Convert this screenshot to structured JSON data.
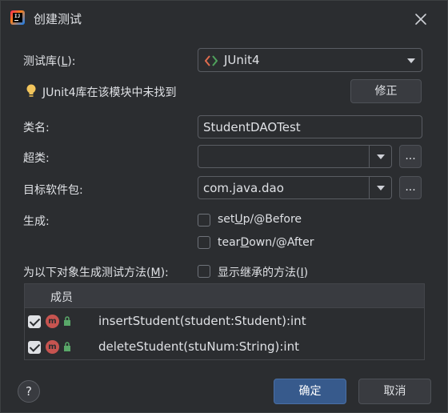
{
  "window": {
    "title": "创建测试"
  },
  "form": {
    "test_library": {
      "label": "测试库(",
      "mnemonic": "L",
      "label_end": "):",
      "value": "JUnit4"
    },
    "warning": {
      "text": "JUnit4库在该模块中未找到",
      "fix_label": "修正"
    },
    "class_name": {
      "label": "类名:",
      "value": "StudentDAOTest"
    },
    "superclass": {
      "label": "超类:",
      "value": ""
    },
    "target_package": {
      "label": "目标软件包:",
      "value": "com.java.dao"
    },
    "ellipsis_label": "...",
    "generate": {
      "label": "生成:",
      "setup": {
        "prefix": "set",
        "mnemonic": "U",
        "suffix": "p/@Before",
        "checked": false
      },
      "teardown": {
        "prefix": "tear",
        "mnemonic": "D",
        "suffix": "own/@After",
        "checked": false
      }
    },
    "methods_for": {
      "label": "为以下对象生成测试方法(",
      "mnemonic": "M",
      "label_end": "):"
    },
    "show_inherited": {
      "label": "显示继承的方法(",
      "mnemonic": "I",
      "label_end": ")",
      "checked": false
    }
  },
  "members": {
    "header": "成员",
    "rows": [
      {
        "signature": "insertStudent(student:Student):int",
        "checked": true,
        "icon": "m"
      },
      {
        "signature": "deleteStudent(stuNum:String):int",
        "checked": true,
        "icon": "m"
      }
    ]
  },
  "footer": {
    "help": "?",
    "ok_label": "确定",
    "cancel_label": "取消"
  }
}
